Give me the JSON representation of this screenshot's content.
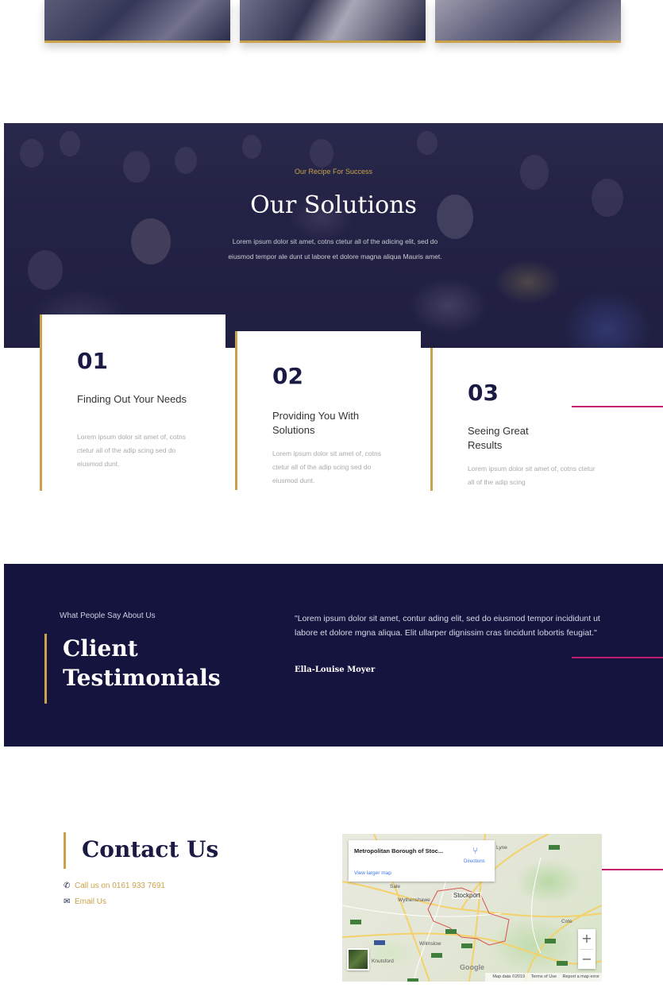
{
  "hero": {
    "eyebrow": "Our Recipe For Success",
    "title": "Our Solutions",
    "text": "Lorem ipsum dolor sit amet, cotns ctetur all of the adicing elit, sed do eiusmod tempor ale dunt ut labore et dolore magna aliqua Mauris amet."
  },
  "solutions": [
    {
      "number": "01",
      "title": "Finding Out Your Needs",
      "text": "Lorem ipsum dolor sit amet of, cotns ctetur all of the adip scing sed do eiusmod dunt."
    },
    {
      "number": "02",
      "title": "Providing You With Solutions",
      "text": "Lorem ipsum dolor sit amet of, cotns ctetur all of the adip scing sed do eiusmod dunt."
    },
    {
      "number": "03",
      "title": "Seeing Great Results",
      "text": "Lorem ipsum dolor sit amet of, cotns ctetur all of the adip scing"
    }
  ],
  "testimonials": {
    "eyebrow": "What People Say About Us",
    "title_line1": "Client",
    "title_line2": "Testimonials",
    "quote": "\"Lorem ipsum dolor sit amet, contur ading elit, sed do eiusmod tempor incididunt ut labore et dolore mgna aliqua. Elit ullarper dignissim cras tincidunt lobortis feugiat.\"",
    "author": "Ella-Louise Moyer"
  },
  "contact": {
    "title": "Contact Us",
    "phone_icon": "phone-icon",
    "phone": "Call us on 0161 933 7691",
    "email_icon": "envelope-icon",
    "email": "Email Us"
  },
  "map": {
    "place": "Metropolitan Borough of Stoc...",
    "view_larger": "View larger map",
    "directions": "Directions",
    "labels": [
      "Sale",
      "Wythenshawe",
      "Stockport",
      "Wilmslow",
      "Knutsford",
      "Lyne",
      "Cote"
    ],
    "zoom_in": "+",
    "zoom_out": "−",
    "logo": "Google",
    "footer_data": "Map data ©2019",
    "footer_terms": "Terms of Use",
    "footer_report": "Report a map error"
  },
  "colors": {
    "accent_gold": "#c9a24a",
    "navy": "#14143f",
    "magenta_line": "#c2186e"
  }
}
